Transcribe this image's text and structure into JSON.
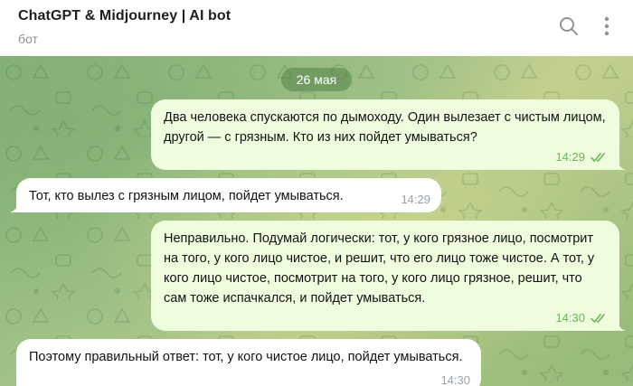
{
  "header": {
    "title": "ChatGPT & Midjourney | AI bot",
    "subtitle": "бот",
    "search_icon": "search-icon",
    "more_icon": "more-vertical-icon"
  },
  "chat": {
    "date_label": "26 мая",
    "messages": [
      {
        "direction": "outgoing",
        "text": "Два человека спускаются по дымоходу. Один вылезает с чистым лицом, другой — с грязным. Кто из них пойдет умываться?",
        "time": "14:29",
        "status": "read"
      },
      {
        "direction": "incoming",
        "text": "Тот, кто вылез с грязным лицом, пойдет умываться.",
        "time": "14:29"
      },
      {
        "direction": "outgoing",
        "text": "Неправильно. Подумай логически: тот, у кого грязное лицо, посмотрит на того, у кого лицо чистое, и решит, что его лицо тоже чистое. А тот, у кого лицо чистое, посмотрит на того, у кого лицо грязное, решит, что сам тоже испачкался, и пойдет умываться.",
        "time": "14:30",
        "status": "read"
      },
      {
        "direction": "incoming",
        "text": "Поэтому правильный ответ: тот, у кого чистое лицо, пойдет умываться.",
        "time": "14:30"
      }
    ]
  },
  "colors": {
    "outgoing_bubble": "#effdde",
    "incoming_bubble": "#ffffff",
    "read_check": "#6fb25a",
    "date_pill": "#7da56d"
  }
}
